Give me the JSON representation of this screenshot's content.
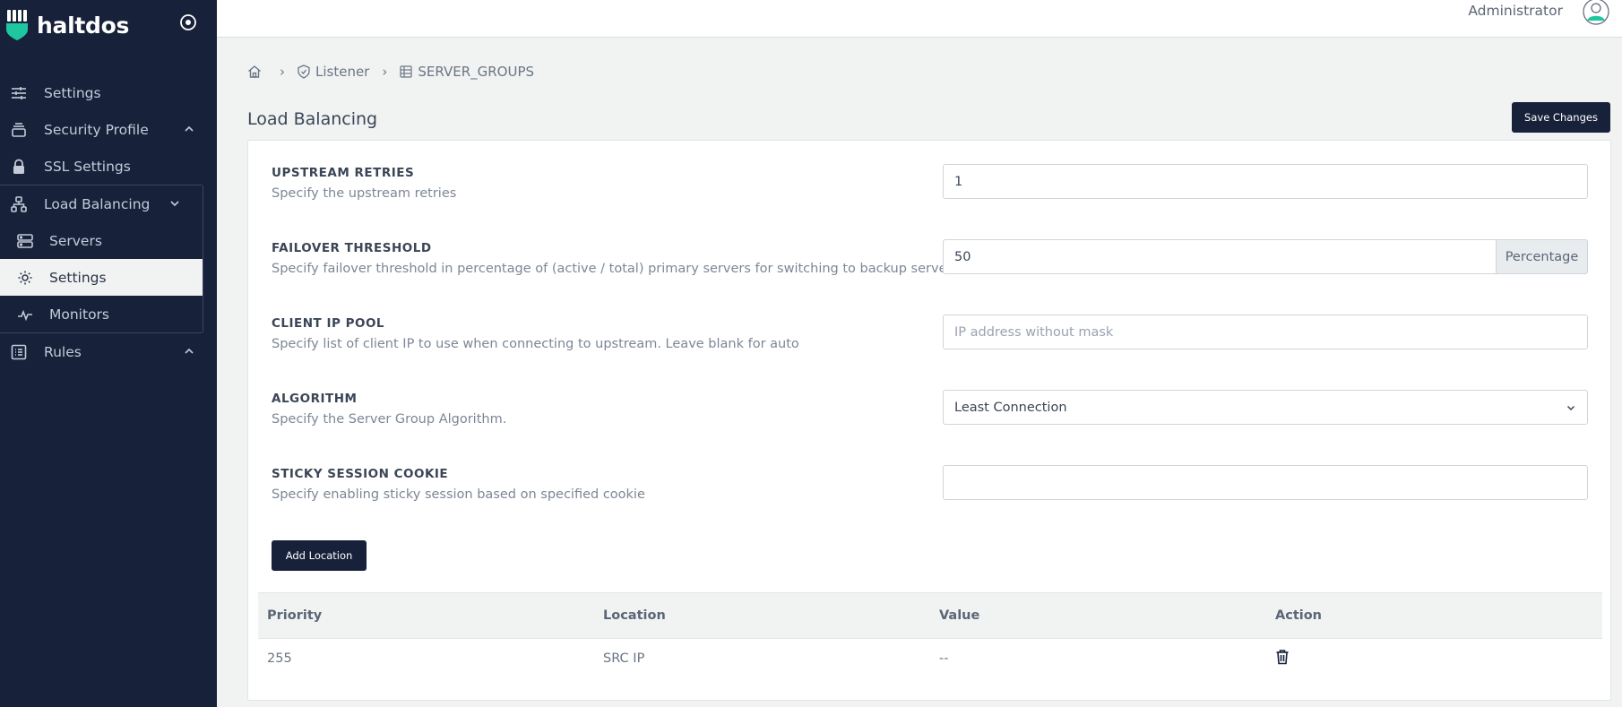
{
  "app": {
    "brand": "haltdos"
  },
  "sidebar": {
    "items": [
      {
        "label": "Settings",
        "icon": "sliders-icon"
      },
      {
        "label": "Security Profile",
        "icon": "layers-icon",
        "chevron": "chevron-up-icon"
      },
      {
        "label": "SSL Settings",
        "icon": "lock-icon"
      },
      {
        "label": "Load Balancing",
        "icon": "sitemap-icon",
        "chevron": "chevron-down-icon"
      },
      {
        "label": "Rules",
        "icon": "list-icon",
        "chevron": "chevron-up-icon"
      }
    ],
    "load_balancing_sub": [
      {
        "label": "Servers",
        "icon": "server-icon"
      },
      {
        "label": "Settings",
        "icon": "sun-gear-icon",
        "active": true
      },
      {
        "label": "Monitors",
        "icon": "activity-icon"
      }
    ]
  },
  "topbar": {
    "user": "Administrator"
  },
  "breadcrumb": {
    "listener": "Listener",
    "group": "SERVER_GROUPS"
  },
  "page": {
    "title": "Load Balancing",
    "save_label": "Save Changes"
  },
  "form": {
    "upstream_retries": {
      "label": "UPSTREAM RETRIES",
      "desc": "Specify the upstream retries",
      "value": "1"
    },
    "failover_threshold": {
      "label": "FAILOVER THRESHOLD",
      "desc": "Specify failover threshold in percentage of (active / total) primary servers for switching to backup servers",
      "value": "50",
      "addon": "Percentage"
    },
    "client_ip_pool": {
      "label": "CLIENT IP POOL",
      "desc": "Specify list of client IP to use when connecting to upstream. Leave blank for auto",
      "value": "",
      "placeholder": "IP address without mask"
    },
    "algorithm": {
      "label": "ALGORITHM",
      "desc": "Specify the Server Group Algorithm.",
      "value": "Least Connection"
    },
    "sticky_session_cookie": {
      "label": "STICKY SESSION COOKIE",
      "desc": "Specify enabling sticky session based on specified cookie",
      "value": ""
    }
  },
  "add_location_label": "Add Location",
  "table": {
    "headers": [
      "Priority",
      "Location",
      "Value",
      "Action"
    ],
    "rows": [
      {
        "priority": "255",
        "location": "SRC IP",
        "value": "--",
        "action_icon": "trash-icon"
      }
    ]
  }
}
